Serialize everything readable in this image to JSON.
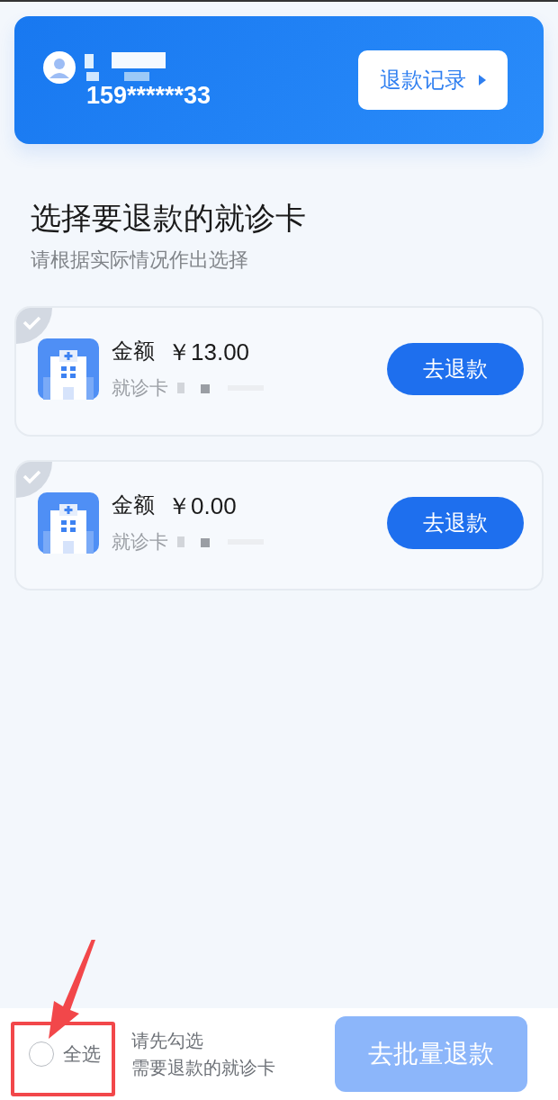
{
  "account": {
    "phone": "159******33",
    "records_button": "退款记录"
  },
  "heading": {
    "title": "选择要退款的就诊卡",
    "subtitle": "请根据实际情况作出选择"
  },
  "cards": [
    {
      "selected": false,
      "amount_label": "金额",
      "amount": "￥13.00",
      "card_label": "就诊卡",
      "action": "去退款"
    },
    {
      "selected": false,
      "amount_label": "金额",
      "amount": "￥0.00",
      "card_label": "就诊卡",
      "action": "去退款"
    }
  ],
  "bottom_bar": {
    "select_all": {
      "label": "全选",
      "checked": false
    },
    "hint_lines": [
      "请先勾选",
      "需要退款的就诊卡"
    ],
    "batch_button": {
      "label": "去批量退款",
      "disabled": true
    }
  }
}
